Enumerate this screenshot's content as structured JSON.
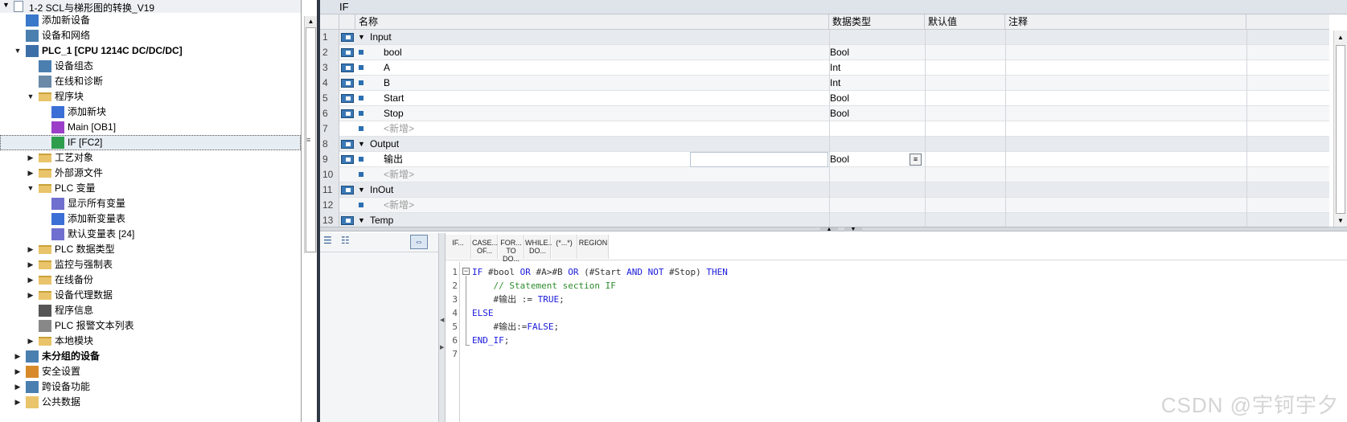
{
  "project_tree": {
    "title": "1-2 SCL与梯形图的转换_V19",
    "items": [
      {
        "label": "添加新设备",
        "indent": 1,
        "icon": "add-device-icon",
        "expander": ""
      },
      {
        "label": "设备和网络",
        "indent": 1,
        "icon": "network-icon",
        "expander": ""
      },
      {
        "label": "PLC_1 [CPU 1214C DC/DC/DC]",
        "indent": 1,
        "icon": "plc-icon",
        "expander": "open",
        "bold": true
      },
      {
        "label": "设备组态",
        "indent": 2,
        "icon": "device-config-icon",
        "expander": ""
      },
      {
        "label": "在线和诊断",
        "indent": 2,
        "icon": "online-diagnostics-icon",
        "expander": ""
      },
      {
        "label": "程序块",
        "indent": 2,
        "icon": "folder-icon",
        "expander": "open"
      },
      {
        "label": "添加新块",
        "indent": 3,
        "icon": "add-block-icon",
        "expander": ""
      },
      {
        "label": "Main [OB1]",
        "indent": 3,
        "icon": "ob-block-icon",
        "expander": ""
      },
      {
        "label": "IF [FC2]",
        "indent": 3,
        "icon": "fc-block-icon",
        "expander": "",
        "selected": true
      },
      {
        "label": "工艺对象",
        "indent": 2,
        "icon": "folder-icon",
        "expander": "closed"
      },
      {
        "label": "外部源文件",
        "indent": 2,
        "icon": "folder-icon",
        "expander": "closed"
      },
      {
        "label": "PLC 变量",
        "indent": 2,
        "icon": "folder-icon",
        "expander": "open"
      },
      {
        "label": "显示所有变量",
        "indent": 3,
        "icon": "show-tags-icon",
        "expander": ""
      },
      {
        "label": "添加新变量表",
        "indent": 3,
        "icon": "add-tag-table-icon",
        "expander": ""
      },
      {
        "label": "默认变量表 [24]",
        "indent": 3,
        "icon": "tag-table-icon",
        "expander": ""
      },
      {
        "label": "PLC 数据类型",
        "indent": 2,
        "icon": "folder-icon",
        "expander": "closed"
      },
      {
        "label": "监控与强制表",
        "indent": 2,
        "icon": "folder-icon",
        "expander": "closed"
      },
      {
        "label": "在线备份",
        "indent": 2,
        "icon": "folder-icon",
        "expander": "closed"
      },
      {
        "label": "设备代理数据",
        "indent": 2,
        "icon": "folder-icon",
        "expander": "closed"
      },
      {
        "label": "程序信息",
        "indent": 2,
        "icon": "program-info-icon",
        "expander": ""
      },
      {
        "label": "PLC 报警文本列表",
        "indent": 2,
        "icon": "alarm-text-icon",
        "expander": ""
      },
      {
        "label": "本地模块",
        "indent": 2,
        "icon": "folder-icon",
        "expander": "closed"
      },
      {
        "label": "未分组的设备",
        "indent": 1,
        "icon": "ungrouped-devices-icon",
        "expander": "closed",
        "bold": true
      },
      {
        "label": "安全设置",
        "indent": 1,
        "icon": "security-icon",
        "expander": "closed"
      },
      {
        "label": "跨设备功能",
        "indent": 1,
        "icon": "cross-device-icon",
        "expander": "closed"
      },
      {
        "label": "公共数据",
        "indent": 1,
        "icon": "common-data-icon",
        "expander": "closed"
      }
    ]
  },
  "interface": {
    "block_title": "IF",
    "headers": {
      "name": "名称",
      "type": "数据类型",
      "default": "默认值",
      "comment": "注释"
    },
    "rows": [
      {
        "num": "1",
        "kind": "group",
        "name": "Input",
        "type": ""
      },
      {
        "num": "2",
        "kind": "var",
        "name": "bool",
        "type": "Bool"
      },
      {
        "num": "3",
        "kind": "var",
        "name": "A",
        "type": "Int"
      },
      {
        "num": "4",
        "kind": "var",
        "name": "B",
        "type": "Int"
      },
      {
        "num": "5",
        "kind": "var",
        "name": "Start",
        "type": "Bool"
      },
      {
        "num": "6",
        "kind": "var",
        "name": "Stop",
        "type": "Bool"
      },
      {
        "num": "7",
        "kind": "new",
        "name": "<新增>",
        "type": ""
      },
      {
        "num": "8",
        "kind": "group",
        "name": "Output",
        "type": ""
      },
      {
        "num": "9",
        "kind": "var-edit",
        "name": "输出",
        "type": "Bool"
      },
      {
        "num": "10",
        "kind": "new",
        "name": "<新增>",
        "type": ""
      },
      {
        "num": "11",
        "kind": "group",
        "name": "InOut",
        "type": ""
      },
      {
        "num": "12",
        "kind": "new",
        "name": "<新增>",
        "type": ""
      },
      {
        "num": "13",
        "kind": "group",
        "name": "Temp",
        "type": ""
      }
    ]
  },
  "editor": {
    "keyword_buttons": [
      "IF...",
      "CASE... OF...",
      "FOR... TO DO...",
      "WHILE... DO...",
      "(*...*)",
      "REGION"
    ],
    "line_numbers": [
      "1",
      "2",
      "3",
      "4",
      "5",
      "6",
      "7"
    ],
    "code": [
      [
        {
          "t": "IF",
          "c": "k"
        },
        {
          "t": " #bool ",
          "c": "v"
        },
        {
          "t": "OR",
          "c": "k"
        },
        {
          "t": " #A>#B ",
          "c": "v"
        },
        {
          "t": "OR",
          "c": "k"
        },
        {
          "t": " (#Start ",
          "c": "v"
        },
        {
          "t": "AND NOT",
          "c": "k"
        },
        {
          "t": " #Stop) ",
          "c": "v"
        },
        {
          "t": "THEN",
          "c": "k"
        }
      ],
      [
        {
          "t": "    ",
          "c": "v"
        },
        {
          "t": "// Statement section IF",
          "c": "cm"
        }
      ],
      [
        {
          "t": "    #输出 := ",
          "c": "v"
        },
        {
          "t": "TRUE",
          "c": "k"
        },
        {
          "t": ";",
          "c": "v"
        }
      ],
      [
        {
          "t": "ELSE",
          "c": "k"
        }
      ],
      [
        {
          "t": "    #输出:=",
          "c": "v"
        },
        {
          "t": "FALSE",
          "c": "k"
        },
        {
          "t": ";",
          "c": "v"
        }
      ],
      [
        {
          "t": "END_IF",
          "c": "k"
        },
        {
          "t": ";",
          "c": "v"
        }
      ],
      []
    ]
  },
  "watermark": "CSDN @宇钶宇夕"
}
